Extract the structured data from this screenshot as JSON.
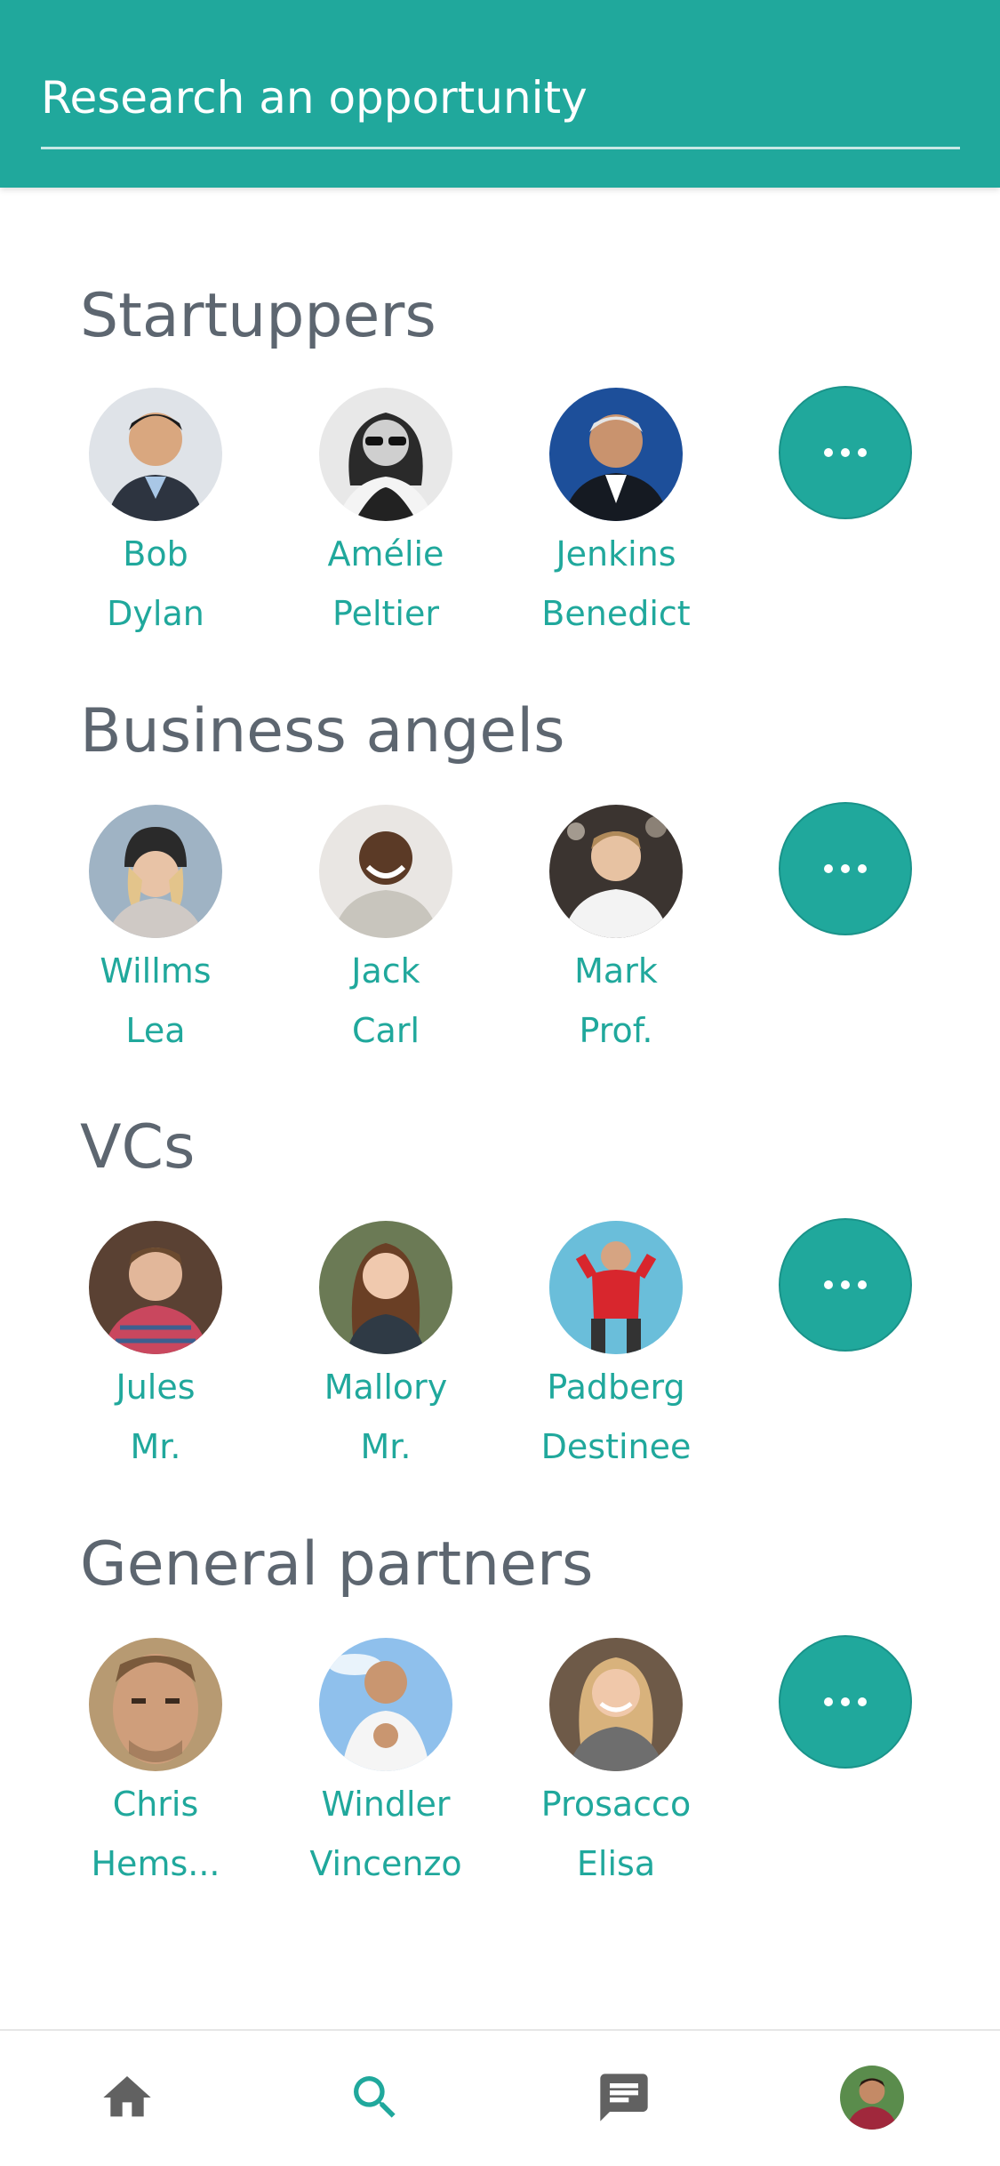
{
  "search": {
    "placeholder": "Research an opportunity"
  },
  "colors": {
    "accent": "#20a89c",
    "heading": "#5d6670",
    "nav_icon": "#616161"
  },
  "sections": [
    {
      "title": "Startuppers",
      "people": [
        {
          "first": "Bob",
          "second": "Dylan",
          "avatar": "man-in-suit-smiling"
        },
        {
          "first": "Amélie",
          "second": "Peltier",
          "avatar": "woman-with-sunglasses-bw"
        },
        {
          "first": "Jenkins",
          "second": "Benedict",
          "avatar": "older-man-in-suit"
        }
      ],
      "more_icon": "more-horizontal-icon"
    },
    {
      "title": "Business angels",
      "people": [
        {
          "first": "Willms",
          "second": "Lea",
          "avatar": "woman-in-beanie"
        },
        {
          "first": "Jack",
          "second": "Carl",
          "avatar": "man-smiling-outdoors"
        },
        {
          "first": "Mark",
          "second": "Prof.",
          "avatar": "young-man-white-shirt"
        }
      ],
      "more_icon": "more-horizontal-icon"
    },
    {
      "title": "VCs",
      "people": [
        {
          "first": "Jules",
          "second": "Mr.",
          "avatar": "man-plaid-shirt"
        },
        {
          "first": "Mallory",
          "second": "Mr.",
          "avatar": "woman-long-hair"
        },
        {
          "first": "Padberg",
          "second": "Destinee",
          "avatar": "man-red-sweater-blue-wall"
        }
      ],
      "more_icon": "more-horizontal-icon"
    },
    {
      "title": "General partners",
      "people": [
        {
          "first": "Chris",
          "second": "Hems...",
          "avatar": "man-close-up-face"
        },
        {
          "first": "Windler",
          "second": "Vincenzo",
          "avatar": "man-thumbs-up"
        },
        {
          "first": "Prosacco",
          "second": "Elisa",
          "avatar": "woman-blonde-smiling"
        }
      ],
      "more_icon": "more-horizontal-icon"
    }
  ],
  "bottom_nav": [
    {
      "name": "home",
      "icon": "home-icon",
      "active": false
    },
    {
      "name": "search",
      "icon": "search-icon",
      "active": true
    },
    {
      "name": "messages",
      "icon": "message-icon",
      "active": false
    },
    {
      "name": "profile",
      "icon": "profile-avatar",
      "active": false
    }
  ]
}
